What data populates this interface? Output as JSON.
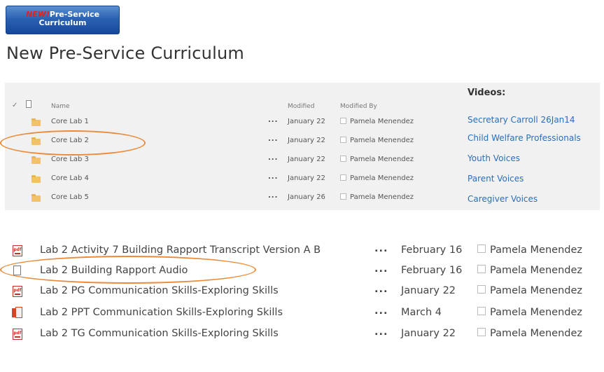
{
  "banner": {
    "new": "NEW!",
    "line1": "Pre-Service",
    "line2": "Curriculum"
  },
  "page_title": "New Pre-Service Curriculum",
  "library": {
    "headers": {
      "name": "Name",
      "modified": "Modified",
      "modified_by": "Modified By"
    },
    "rows": [
      {
        "name": "Core Lab 1",
        "modified": "January 22",
        "by": "Pamela Menendez"
      },
      {
        "name": "Core Lab 2",
        "modified": "January 22",
        "by": "Pamela Menendez"
      },
      {
        "name": "Core Lab 3",
        "modified": "January 22",
        "by": "Pamela Menendez"
      },
      {
        "name": "Core Lab 4",
        "modified": "January 22",
        "by": "Pamela Menendez"
      },
      {
        "name": "Core Lab 5",
        "modified": "January 26",
        "by": "Pamela Menendez"
      }
    ],
    "ellipsis": "..."
  },
  "videos": {
    "title": "Videos:",
    "links": [
      "Secretary Carroll 26Jan14",
      "Child Welfare Professionals",
      "Youth Voices",
      "Parent Voices",
      "Caregiver Voices"
    ]
  },
  "files": {
    "rows": [
      {
        "icon": "pdf-icon",
        "name": "Lab 2 Activity 7 Building Rapport Transcript Version A B",
        "modified": "February 16",
        "by": "Pamela Menendez"
      },
      {
        "icon": "document-icon",
        "name": "Lab 2 Building Rapport Audio",
        "modified": "February 16",
        "by": "Pamela Menendez"
      },
      {
        "icon": "pdf-icon",
        "name": "Lab 2 PG Communication Skills-Exploring Skills",
        "modified": "January 22",
        "by": "Pamela Menendez"
      },
      {
        "icon": "powerpoint-icon",
        "name": "Lab 2 PPT Communication Skills-Exploring Skills",
        "modified": "March 4",
        "by": "Pamela Menendez"
      },
      {
        "icon": "pdf-icon",
        "name": "Lab 2 TG Communication Skills-Exploring Skills",
        "modified": "January 22",
        "by": "Pamela Menendez"
      }
    ],
    "ellipsis": "...",
    "pdf_glyph": "pdf"
  },
  "colors": {
    "link": "#2a6ebb",
    "highlight": "#ea8a3a",
    "panel": "#f1f1f1"
  }
}
